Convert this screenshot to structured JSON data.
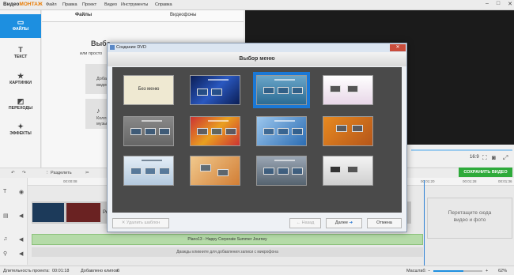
{
  "app": {
    "logo_a": "Видео",
    "logo_b": "МОНТАЖ",
    "menu": [
      "Файл",
      "Правка",
      "Проект",
      "Видео",
      "Инструменты",
      "Справка"
    ]
  },
  "sidebar": [
    {
      "label": "ФАЙЛЫ",
      "icon": "folder-icon"
    },
    {
      "label": "ТЕКСТ",
      "icon": "text-icon"
    },
    {
      "label": "КАРТИНКИ",
      "icon": "star-icon"
    },
    {
      "label": "ПЕРЕХОДЫ",
      "icon": "transition-icon"
    },
    {
      "label": "ЭФФЕКТЫ",
      "icon": "effects-icon"
    }
  ],
  "tabs": [
    "Файлы",
    "Видеофоны"
  ],
  "files": {
    "hint1": "Выбе",
    "hint2": "или просто",
    "card1a": "Добавить",
    "card1b": "видео",
    "card2a": "Колл",
    "card2b": "музы"
  },
  "preview": {
    "ratio": "16:9"
  },
  "toolbar": {
    "split": "Разделить",
    "save": "СОХРАНИТЬ ВИДЕО"
  },
  "ruler": [
    "00:00:08",
    "00:00:16",
    "00:00:24",
    "00:01:12",
    "00:01:20",
    "00:01:28",
    "00:01:36"
  ],
  "timeline": {
    "drop_1": "Перетащите сюда",
    "drop_2": "видео и фото",
    "audio": "Plano13 - Happy Corporate Summer Journey",
    "voice": "Дважды кликните для добавления записи с микрофона",
    "clip_label": "Ре"
  },
  "status": {
    "duration_label": "Длительность проекта:",
    "duration": "00:01:18",
    "clips_label": "Добавлено клипов:",
    "clips": "6",
    "zoom_label": "Масштаб:",
    "zoom": "62%",
    "zoom_fraction": 0.62
  },
  "dialog": {
    "title": "Создание DVD",
    "heading": "Выбор меню",
    "no_menu": "Без меню",
    "thumb_caption": "Заголовок DVD",
    "buttons": {
      "delete": "Удалить шаблон",
      "back": "Назад",
      "next": "Далее",
      "cancel": "Отмена"
    }
  }
}
